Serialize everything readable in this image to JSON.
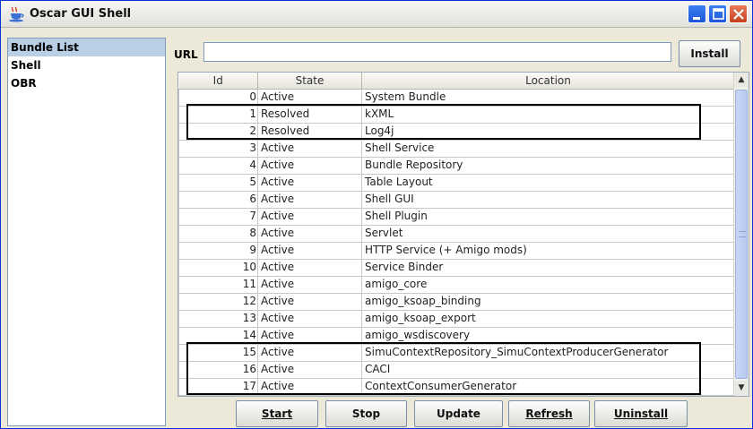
{
  "window": {
    "title": "Oscar GUI Shell"
  },
  "sidebar": {
    "items": [
      {
        "label": "Bundle List",
        "selected": true
      },
      {
        "label": "Shell",
        "selected": false
      },
      {
        "label": "OBR",
        "selected": false
      }
    ]
  },
  "url_bar": {
    "label": "URL",
    "value": "",
    "install_label": "Install"
  },
  "table": {
    "headers": {
      "id": "Id",
      "state": "State",
      "location": "Location"
    },
    "rows": [
      {
        "id": "0",
        "state": "Active",
        "location": "System Bundle"
      },
      {
        "id": "1",
        "state": "Resolved",
        "location": "kXML"
      },
      {
        "id": "2",
        "state": "Resolved",
        "location": "Log4j"
      },
      {
        "id": "3",
        "state": "Active",
        "location": "Shell Service"
      },
      {
        "id": "4",
        "state": "Active",
        "location": "Bundle Repository"
      },
      {
        "id": "5",
        "state": "Active",
        "location": "Table Layout"
      },
      {
        "id": "6",
        "state": "Active",
        "location": "Shell GUI"
      },
      {
        "id": "7",
        "state": "Active",
        "location": "Shell Plugin"
      },
      {
        "id": "8",
        "state": "Active",
        "location": "Servlet"
      },
      {
        "id": "9",
        "state": "Active",
        "location": "HTTP Service (+ Amigo mods)"
      },
      {
        "id": "10",
        "state": "Active",
        "location": "Service Binder"
      },
      {
        "id": "11",
        "state": "Active",
        "location": "amigo_core"
      },
      {
        "id": "12",
        "state": "Active",
        "location": "amigo_ksoap_binding"
      },
      {
        "id": "13",
        "state": "Active",
        "location": "amigo_ksoap_export"
      },
      {
        "id": "14",
        "state": "Active",
        "location": "amigo_wsdiscovery"
      },
      {
        "id": "15",
        "state": "Active",
        "location": "SimuContextRepository_SimuContextProducerGenerator"
      },
      {
        "id": "16",
        "state": "Active",
        "location": "CACI"
      },
      {
        "id": "17",
        "state": "Active",
        "location": "ContextConsumerGenerator"
      }
    ]
  },
  "actions": {
    "start": "Start",
    "stop": "Stop",
    "update": "Update",
    "refresh": "Refresh",
    "uninstall": "Uninstall"
  },
  "colors": {
    "selection": "#b8cfe5",
    "window_bg": "#ece9d8",
    "titlebar_button": "#2a66e6",
    "close_button": "#d9542e"
  }
}
